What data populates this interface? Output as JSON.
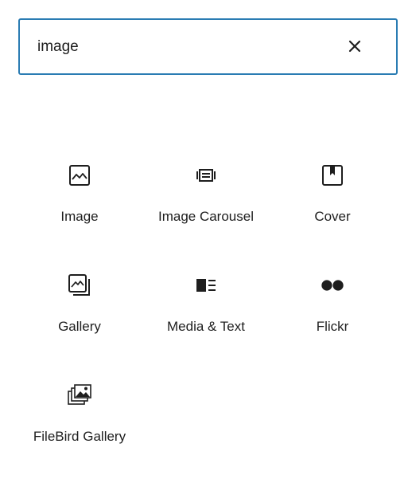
{
  "search": {
    "value": "image",
    "clear_icon": "close-icon"
  },
  "blocks": [
    {
      "label": "Image",
      "icon": "image-icon"
    },
    {
      "label": "Image Carousel",
      "icon": "carousel-icon"
    },
    {
      "label": "Cover",
      "icon": "cover-icon"
    },
    {
      "label": "Gallery",
      "icon": "gallery-icon"
    },
    {
      "label": "Media & Text",
      "icon": "media-text-icon"
    },
    {
      "label": "Flickr",
      "icon": "flickr-icon"
    },
    {
      "label": "FileBird Gallery",
      "icon": "filebird-gallery-icon"
    }
  ],
  "colors": {
    "focus_border": "#2a7cb3",
    "text": "#1e1e1e"
  }
}
